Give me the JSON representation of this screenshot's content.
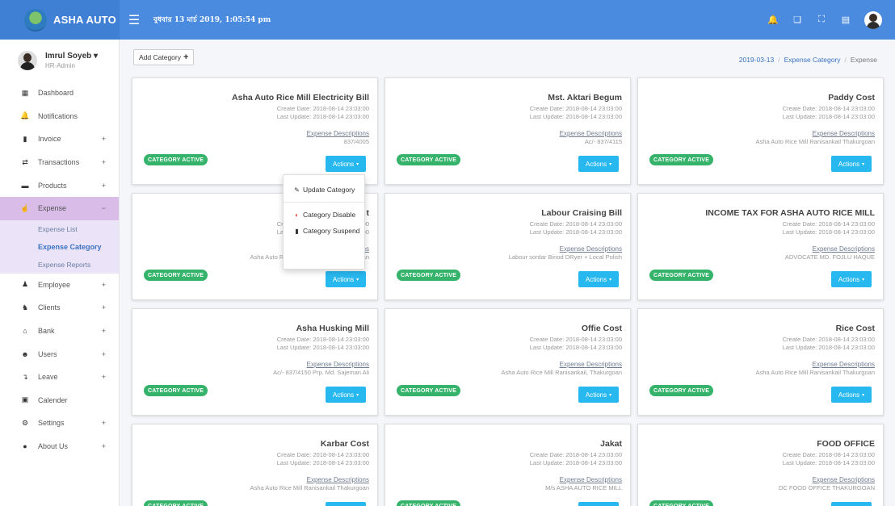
{
  "header": {
    "brand": "ASHA AUTO",
    "datetime": "বুধবার 13 মার্চ 2019, 1:05:54 pm",
    "icons": [
      "bell-icon",
      "book-icon",
      "fullscreen-icon",
      "message-icon",
      "avatar"
    ]
  },
  "user": {
    "name": "Imrul Soyeb",
    "role": "HR-Admin",
    "caret": "▾"
  },
  "sidebar": {
    "items": [
      {
        "label": "Dashboard",
        "icon": "dashboard-icon",
        "glyph": "▦",
        "plus": ""
      },
      {
        "label": "Notifications",
        "icon": "bell-icon",
        "glyph": "🔔",
        "plus": ""
      },
      {
        "label": "Invoice",
        "icon": "file-icon",
        "glyph": "▮",
        "plus": "+"
      },
      {
        "label": "Transactions",
        "icon": "exchange-icon",
        "glyph": "⇄",
        "plus": "+"
      },
      {
        "label": "Products",
        "icon": "box-icon",
        "glyph": "▬",
        "plus": "+"
      },
      {
        "label": "Expense",
        "icon": "money-hand-icon",
        "glyph": "☝",
        "plus": "−"
      },
      {
        "label": "Employee",
        "icon": "user-icon",
        "glyph": "♟",
        "plus": "+"
      },
      {
        "label": "Clients",
        "icon": "users-icon",
        "glyph": "♞",
        "plus": "+"
      },
      {
        "label": "Bank",
        "icon": "bank-icon",
        "glyph": "⌂",
        "plus": "+"
      },
      {
        "label": "Users",
        "icon": "user-secret-icon",
        "glyph": "☻",
        "plus": "+"
      },
      {
        "label": "Leave",
        "icon": "leave-icon",
        "glyph": "↴",
        "plus": "+"
      },
      {
        "label": "Calender",
        "icon": "calendar-icon",
        "glyph": "▣",
        "plus": ""
      },
      {
        "label": "Settings",
        "icon": "gears-icon",
        "glyph": "⚙",
        "plus": "+"
      },
      {
        "label": "About Us",
        "icon": "map-marker-icon",
        "glyph": "●",
        "plus": "+"
      }
    ],
    "submenu": [
      "Expense List",
      "Expense Category",
      "Expense Reports"
    ]
  },
  "toolbar": {
    "add_label": "Add Category",
    "add_plus": "+"
  },
  "breadcrumb": {
    "date": "2019-03-13",
    "category": "Expense Category",
    "current": "Expense",
    "sep": "/"
  },
  "card_common": {
    "badge": "CATEGORY ACTIVE",
    "actions": "Actions",
    "caret": "▾",
    "desc_label": "Expense Descriptions",
    "create_date": "Create Date: 2018-08-14 23:03:00",
    "last_update": "Last Update: 2018-08-14 23:03:00"
  },
  "cards": [
    {
      "title": "Asha Auto Rice Mill Electricity Bill",
      "desc": "837/4005"
    },
    {
      "title": "Mst. Aktari Begum",
      "desc": "Ac/- 837/4115"
    },
    {
      "title": "Paddy Cost",
      "desc": "Asha Auto Rice Mill Ranisankail Thakurgoan"
    },
    {
      "title": "t",
      "desc": "Asha Auto Rice Mill Ranisankail Thakurgoan"
    },
    {
      "title": "Labour Craising Bill",
      "desc": "Labour sordar Binod DRyer + Local Polish"
    },
    {
      "title": "INCOME TAX FOR ASHA AUTO RICE MILL",
      "desc": "ADVOCATE MD. FOJLU HAQUE"
    },
    {
      "title": "Asha Husking Mill",
      "desc": "Ac/- 837/4150 Prp. Md. Sajeman Ali"
    },
    {
      "title": "Offie Cost",
      "desc": "Asha Auto Rice Mill Ranisankail, Thakurgoan"
    },
    {
      "title": "Rice Cost",
      "desc": "Asha Auto Rice Mill Ranisankail Thakurgoan"
    },
    {
      "title": "Karbar Cost",
      "desc": "Asha Auto Rice Mill Ranisankail Thakurgoan"
    },
    {
      "title": "Jakat",
      "desc": "M/s ASHA AUTO RICE MILL"
    },
    {
      "title": "FOOD OFFICE",
      "desc": "DC FOOD OFFICE THAKURGOAN"
    }
  ],
  "dropdown": {
    "update": "Update Category",
    "disable": "Category Disable",
    "suspend": "Category Suspend",
    "update_glyph": "✎",
    "disable_glyph": "◐",
    "suspend_glyph": "▮"
  },
  "colors": {
    "header": "#4a8be0",
    "active_menu": "#d9bce8",
    "submenu": "#ebe3f7",
    "badge": "#35b36b",
    "action_button": "#28b8f0"
  }
}
